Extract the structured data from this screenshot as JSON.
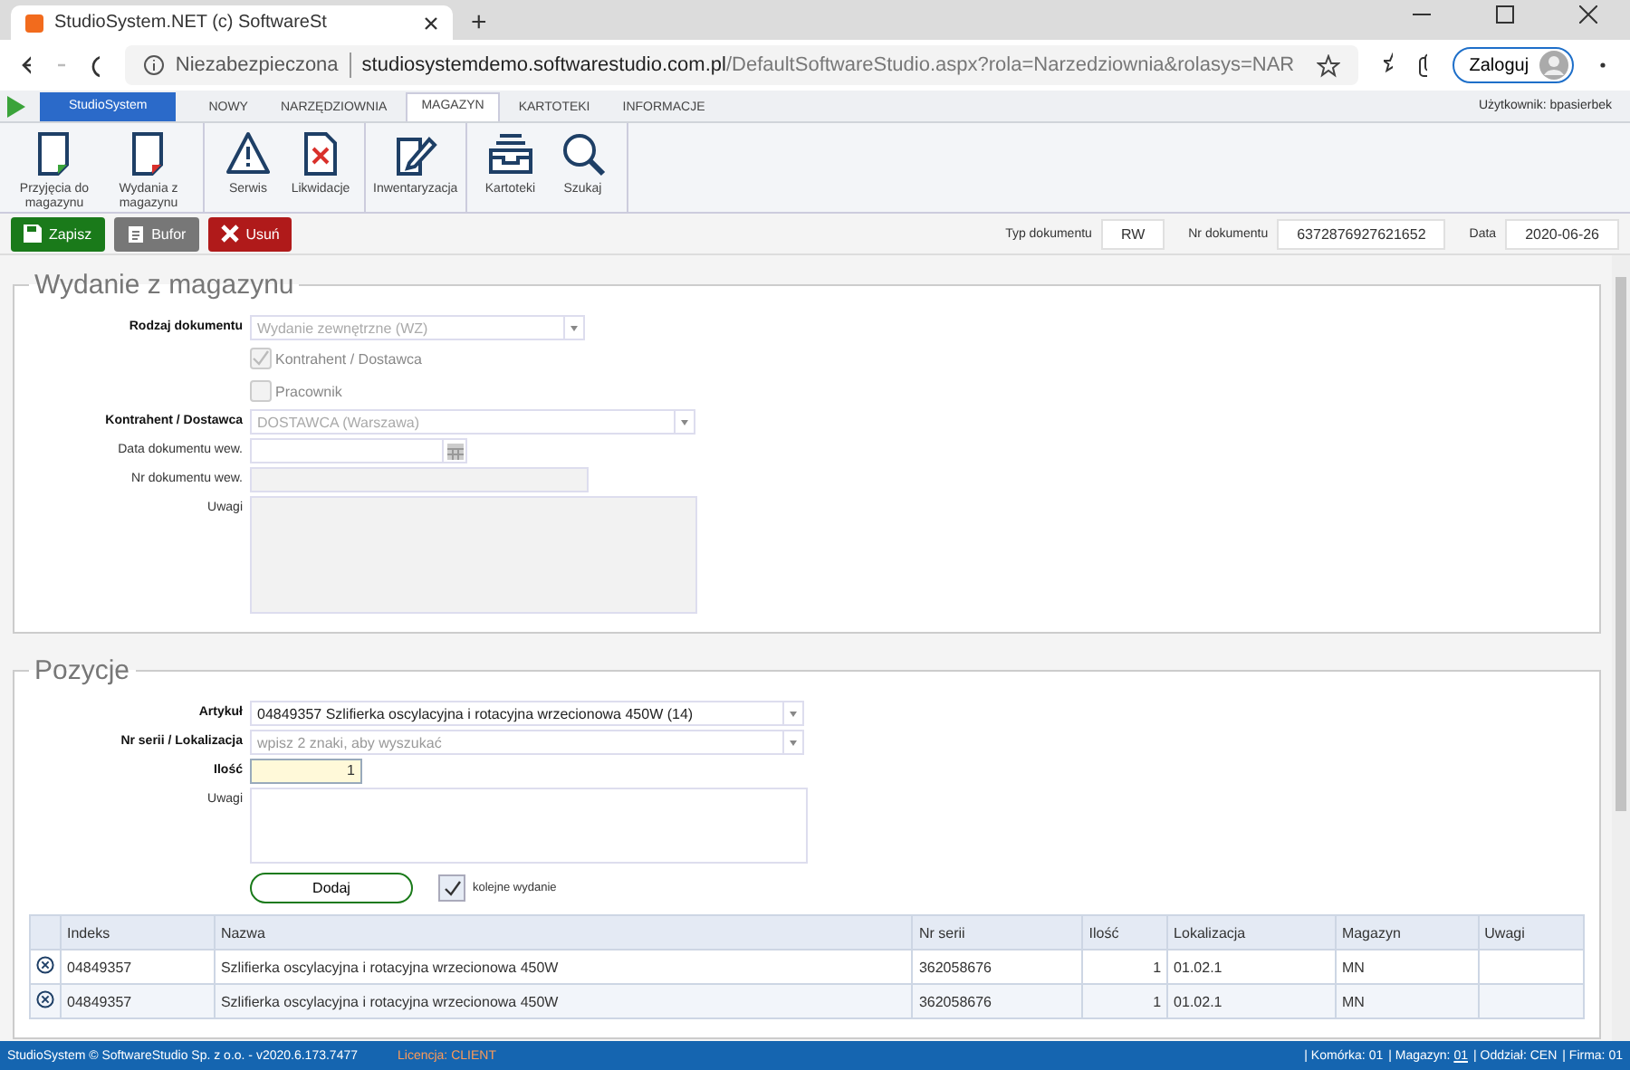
{
  "browser": {
    "tab_title": "StudioSystem.NET (c) SoftwareSt",
    "new_tab": "+",
    "security": "Niezabezpieczona",
    "url_host": "studiosystemdemo.softwarestudio.com.pl",
    "url_path": "/DefaultSoftwareStudio.aspx?rola=Narzedziownia&rolasys=NAR",
    "profile_button": "Zaloguj"
  },
  "menu": {
    "tabs": [
      {
        "label": "StudioSystem",
        "kind": "brand",
        "selected": false
      },
      {
        "label": "NOWY",
        "kind": "tab",
        "selected": false
      },
      {
        "label": "NARZĘDZIOWNIA",
        "kind": "tab",
        "selected": false
      },
      {
        "label": "MAGAZYN",
        "kind": "tab",
        "selected": true
      },
      {
        "label": "KARTOTEKI",
        "kind": "tab",
        "selected": false
      },
      {
        "label": "INFORMACJE",
        "kind": "tab",
        "selected": false
      }
    ],
    "user": "Użytkownik: bpasierbek"
  },
  "ribbon": {
    "groups": [
      {
        "buttons": [
          {
            "label": "Przyjęcia do magazynu",
            "kind": "receipt"
          },
          {
            "label": "Wydania z magazynu",
            "kind": "issue"
          }
        ]
      },
      {
        "buttons": [
          {
            "label": "Serwis",
            "kind": "service"
          },
          {
            "label": "Likwidacje",
            "kind": "disposal"
          }
        ]
      },
      {
        "buttons": [
          {
            "label": "Inwentaryzacja",
            "kind": "inventory"
          }
        ]
      },
      {
        "buttons": [
          {
            "label": "Kartoteki",
            "kind": "records"
          },
          {
            "label": "Szukaj",
            "kind": "search"
          }
        ]
      }
    ]
  },
  "actions": [
    {
      "label": "Zapisz",
      "kind": "save"
    },
    {
      "label": "Bufor",
      "kind": "buffer"
    },
    {
      "label": "Usuń",
      "kind": "delete"
    }
  ],
  "document": [
    {
      "label": "Typ dokumentu",
      "value": "RW"
    },
    {
      "label": "Nr dokumentu",
      "value": "6372876927621652"
    },
    {
      "label": "Data",
      "value": "2020-06-26"
    }
  ],
  "header_section": {
    "title": "Wydanie z magazynu",
    "fields": [
      {
        "kind": "select",
        "label": "Rodzaj dokumentu",
        "required": true,
        "value": "Wydanie zewnętrzne (WZ)",
        "disabled": true
      },
      {
        "kind": "checkbox",
        "label": "Kontrahent / Dostawca",
        "checked": true,
        "disabled": true
      },
      {
        "kind": "checkbox",
        "label": "Pracownik",
        "checked": false,
        "disabled": true
      },
      {
        "kind": "select",
        "label": "Kontrahent / Dostawca",
        "required": true,
        "value": "DOSTAWCA (Warszawa)",
        "disabled": true
      },
      {
        "kind": "date",
        "label": "Data dokumentu wew.",
        "required": false
      },
      {
        "kind": "text",
        "label": "Nr dokumentu wew.",
        "required": false,
        "disabled": true
      },
      {
        "kind": "textarea",
        "label": "Uwagi",
        "required": false,
        "disabled": true
      }
    ]
  },
  "items_section": {
    "title": "Pozycje",
    "fields": [
      {
        "kind": "select",
        "label": "Artykuł",
        "required": true,
        "value": "04849357 Szlifierka oscylacyjna i rotacyjna wrzecionowa 450W (14)",
        "disabled": false
      },
      {
        "kind": "select",
        "label": "Nr serii / Lokalizacja",
        "required": true,
        "placeholder": "wpisz 2 znaki, aby wyszukać",
        "disabled": false
      },
      {
        "kind": "number",
        "label": "Ilość",
        "required": true,
        "value": "1",
        "focused": true
      },
      {
        "kind": "textarea",
        "label": "Uwagi",
        "required": false,
        "disabled": false
      }
    ],
    "add_button": "Dodaj",
    "next_checkbox": {
      "label": "kolejne wydanie",
      "checked": true
    }
  },
  "table": {
    "columns": [
      "Indeks",
      "Nazwa",
      "Nr serii",
      "Ilość",
      "Lokalizacja",
      "Magazyn",
      "Uwagi"
    ],
    "rows": [
      [
        "04849357",
        "Szlifierka oscylacyjna i rotacyjna wrzecionowa 450W",
        "362058676",
        "1",
        "01.02.1",
        "MN"
      ],
      [
        "04849357",
        "Szlifierka oscylacyjna i rotacyjna wrzecionowa 450W",
        "362058676",
        "1",
        "01.02.1",
        "MN"
      ]
    ]
  },
  "status_bar": {
    "copyright": "StudioSystem © SoftwareStudio Sp. z o.o. - v2020.6.173.7477",
    "license": "Licencja: CLIENT",
    "items": [
      {
        "label": "| Komórka:",
        "value": "01",
        "link": false
      },
      {
        "label": "| Magazyn:",
        "value": "01",
        "link": true
      },
      {
        "label": "| Oddział:",
        "value": "CEN",
        "link": false
      },
      {
        "label": "| Firma:",
        "value": "01",
        "link": false
      }
    ]
  }
}
